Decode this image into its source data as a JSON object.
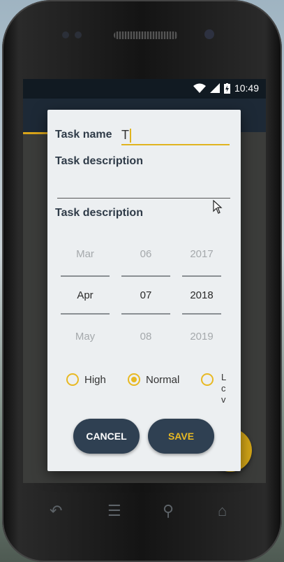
{
  "status": {
    "time": "10:49"
  },
  "dialog": {
    "task_name_label": "Task name",
    "task_name_value": "T",
    "desc_label_1": "Task description",
    "desc_label_2": "Task description",
    "date_picker": {
      "month": {
        "prev": "Mar",
        "current": "Apr",
        "next": "May"
      },
      "day": {
        "prev": "06",
        "current": "07",
        "next": "08"
      },
      "year": {
        "prev": "2017",
        "current": "2018",
        "next": "2019"
      }
    },
    "priority": {
      "high": "High",
      "normal": "Normal",
      "low_partial": [
        "L",
        "c",
        "v"
      ],
      "selected": "Normal"
    },
    "cancel_label": "CANCEL",
    "save_label": "SAVE"
  },
  "colors": {
    "accent": "#e8b923",
    "button_bg": "#2f4052",
    "cancel_text": "#ffffff",
    "save_text": "#e8b923"
  },
  "icons": [
    "wifi-icon",
    "signal-icon",
    "battery-charging-icon",
    "back-icon",
    "menu-icon",
    "search-icon",
    "home-icon",
    "mouse-cursor-icon"
  ]
}
